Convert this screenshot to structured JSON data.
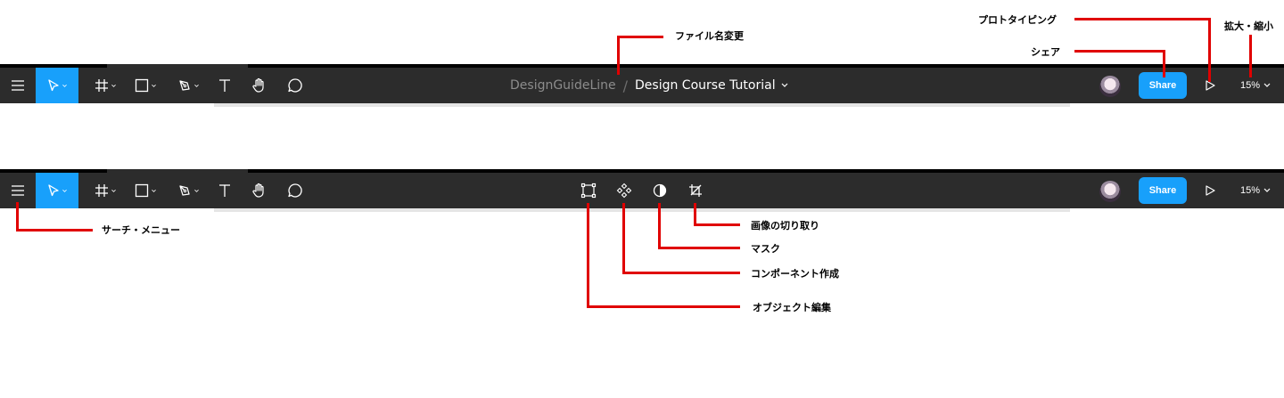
{
  "toolbar_top": {
    "file_parent": "DesignGuideLine",
    "file_separator": "/",
    "file_name": "Design Course Tutorial",
    "share_label": "Share",
    "zoom_label": "15%"
  },
  "toolbar_bottom": {
    "share_label": "Share",
    "zoom_label": "15%"
  },
  "icons": {
    "left_tools": [
      "menu-icon",
      "move-icon",
      "frame-icon",
      "rectangle-icon",
      "pen-icon",
      "text-icon",
      "hand-icon",
      "comment-icon"
    ],
    "selection_tools": [
      "edit-object-icon",
      "component-icon",
      "mask-icon",
      "crop-icon"
    ],
    "right": [
      "avatar",
      "share-button",
      "play-icon",
      "zoom-dropdown"
    ]
  },
  "annotations": {
    "rename_file": "ファイル名変更",
    "prototyping": "プロトタイピング",
    "share": "シェア",
    "zoom": "拡大・縮小",
    "search_menu": "サーチ・メニュー",
    "crop_image": "画像の切り取り",
    "mask": "マスク",
    "create_component": "コンポーネント作成",
    "edit_object": "オブジェクト編集"
  },
  "colors": {
    "toolbar_bg": "#2c2c2c",
    "accent": "#18a0fb",
    "annotation": "#e00000"
  }
}
